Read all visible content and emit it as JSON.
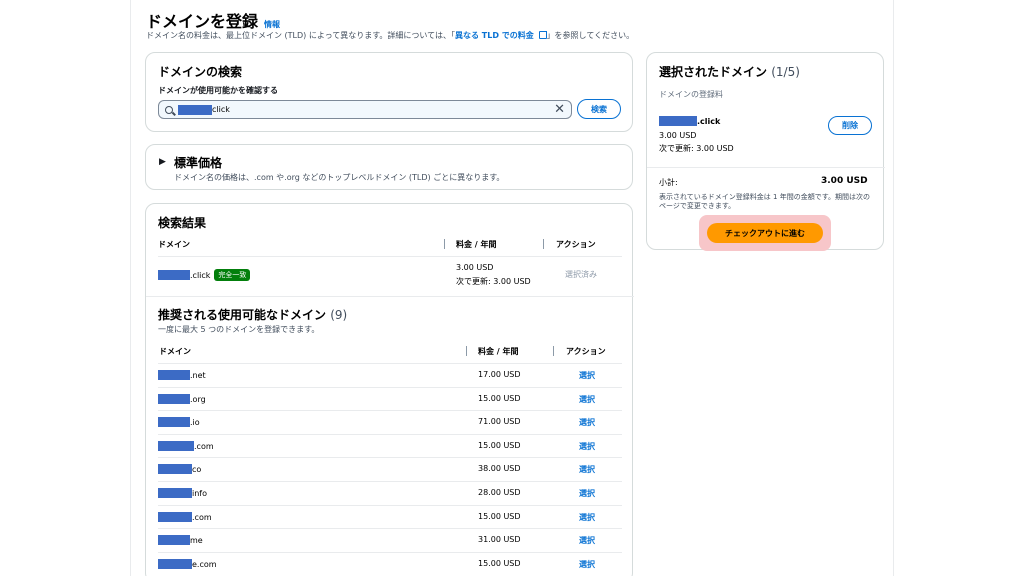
{
  "header": {
    "title": "ドメインを登録",
    "info_link": "情報",
    "subtitle_before": "ドメイン名の料金は、最上位ドメイン (TLD) によって異なります。詳細については、「",
    "subtitle_link": "異なる TLD での料金",
    "subtitle_after": "」を参照してください。"
  },
  "search": {
    "title": "ドメインの検索",
    "label": "ドメインが使用可能かを確認する",
    "value_suffix": "click",
    "button": "検索"
  },
  "standard_price": {
    "title": "標準価格",
    "description": "ドメイン名の価格は、.com や.org などのトップレベルドメイン (TLD) ごとに異なります。"
  },
  "results": {
    "title": "検索結果",
    "columns": [
      "ドメイン",
      "料金 / 年間",
      "アクション"
    ],
    "exact": {
      "domain_suffix": ".click",
      "badge": "完全一致",
      "price": "3.00 USD",
      "renewal": "次で更新: 3.00 USD",
      "action": "選択済み"
    }
  },
  "suggested": {
    "title": "推奨される使用可能なドメイン",
    "count": "(9)",
    "subtitle": "一度に最大 5 つのドメインを登録できます。",
    "columns": [
      "ドメイン",
      "料金 / 年間",
      "アクション"
    ],
    "rows": [
      {
        "suffix": ".net",
        "price": "17.00 USD",
        "action": "選択"
      },
      {
        "suffix": ".org",
        "price": "15.00 USD",
        "action": "選択"
      },
      {
        "suffix": ".io",
        "price": "71.00 USD",
        "action": "選択"
      },
      {
        "suffix": ".com",
        "price": "15.00 USD",
        "action": "選択"
      },
      {
        "suffix": "co",
        "price": "38.00 USD",
        "action": "選択"
      },
      {
        "suffix": "info",
        "price": "28.00 USD",
        "action": "選択"
      },
      {
        "suffix": ".com",
        "price": "15.00 USD",
        "action": "選択"
      },
      {
        "suffix": "me",
        "price": "31.00 USD",
        "action": "選択"
      },
      {
        "suffix": "e.com",
        "price": "15.00 USD",
        "action": "選択"
      }
    ]
  },
  "selected": {
    "title": "選択されたドメイン",
    "count": "(1/5)",
    "fee_label": "ドメインの登録料",
    "domain_suffix": ".click",
    "price": "3.00 USD",
    "renewal": "次で更新: 3.00 USD",
    "remove_button": "削除",
    "subtotal_label": "小計:",
    "subtotal_value": "3.00 USD",
    "note": "表示されているドメイン登録料金は 1 年間の金額です。期間は次のページで変更できます。",
    "checkout_button": "チェックアウトに進む"
  },
  "colors": {
    "link": "#0972d3",
    "checkout": "#ff9900",
    "highlight": "#f7c6c9",
    "badge": "#037f0c",
    "redaction": "#3c6bc5"
  }
}
